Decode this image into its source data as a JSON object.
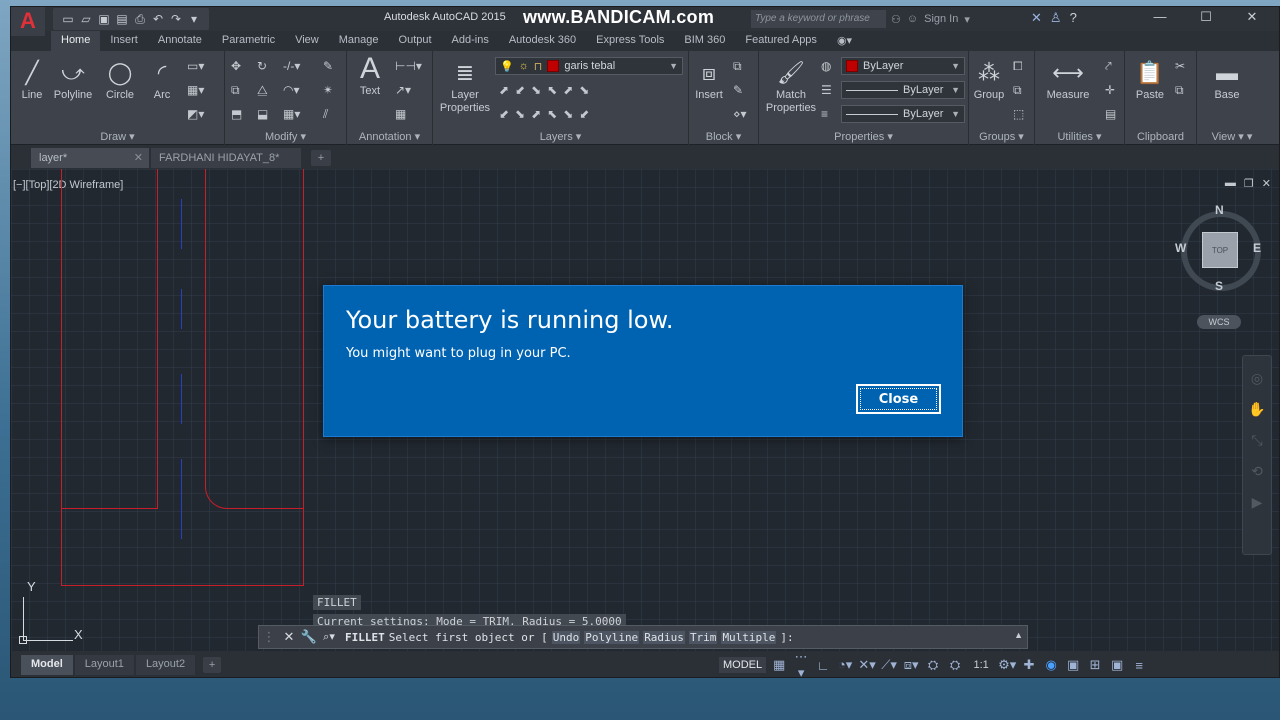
{
  "app": {
    "title": "Autodesk AutoCAD 2015",
    "watermark": "www.BANDICAM.com",
    "search_placeholder": "Type a keyword or phrase",
    "sign_in": "Sign In",
    "logo_letter": "A"
  },
  "ribbon_tabs": [
    "Home",
    "Insert",
    "Annotate",
    "Parametric",
    "View",
    "Manage",
    "Output",
    "Add-ins",
    "Autodesk 360",
    "Express Tools",
    "BIM 360",
    "Featured Apps"
  ],
  "panels": {
    "draw": {
      "title": "Draw",
      "tools": [
        "Line",
        "Polyline",
        "Circle",
        "Arc"
      ]
    },
    "modify": {
      "title": "Modify"
    },
    "annotation": {
      "title": "Annotation",
      "text": "Text"
    },
    "layers": {
      "title": "Layers",
      "layer_properties": "Layer\nProperties",
      "layer_lp1": "Layer",
      "layer_lp2": "Properties",
      "current_layer": "garis tebal"
    },
    "block": {
      "title": "Block",
      "insert": "Insert"
    },
    "properties": {
      "title": "Properties",
      "match1": "Match",
      "match2": "Properties",
      "color": "ByLayer",
      "linetype": "ByLayer",
      "lineweight": "ByLayer"
    },
    "groups": {
      "title": "Groups",
      "group": "Group"
    },
    "utilities": {
      "title": "Utilities",
      "measure": "Measure"
    },
    "clipboard": {
      "title": "Clipboard",
      "paste": "Paste"
    },
    "view": {
      "title": "View",
      "base": "Base"
    }
  },
  "file_tabs": [
    {
      "label": "layer*"
    },
    {
      "label": "FARDHANI HIDAYAT_8*"
    }
  ],
  "viewport": {
    "label": "[−][Top][2D Wireframe]",
    "compass": {
      "n": "N",
      "s": "S",
      "e": "E",
      "w": "W",
      "top": "TOP"
    },
    "wcs": "WCS",
    "ucs_x": "X",
    "ucs_y": "Y"
  },
  "command": {
    "history": [
      "FILLET",
      "Current settings: Mode = TRIM, Radius = 5.0000"
    ],
    "prompt_cmd": "FILLET",
    "prompt_text": "Select first object or [",
    "options": [
      "Undo",
      "Polyline",
      "Radius",
      "Trim",
      "Multiple"
    ],
    "prompt_end": "]:"
  },
  "layout_tabs": [
    "Model",
    "Layout1",
    "Layout2"
  ],
  "status": {
    "model": "MODEL",
    "scale": "1:1"
  },
  "toast": {
    "title": "Your battery is running low.",
    "message": "You might want to plug in your PC.",
    "close": "Close"
  },
  "colors": {
    "accent_toast": "#0063b1",
    "drawing_red": "#c81e2a",
    "drawing_blue": "#2a3fbf",
    "layer_swatch": "#c00000"
  }
}
